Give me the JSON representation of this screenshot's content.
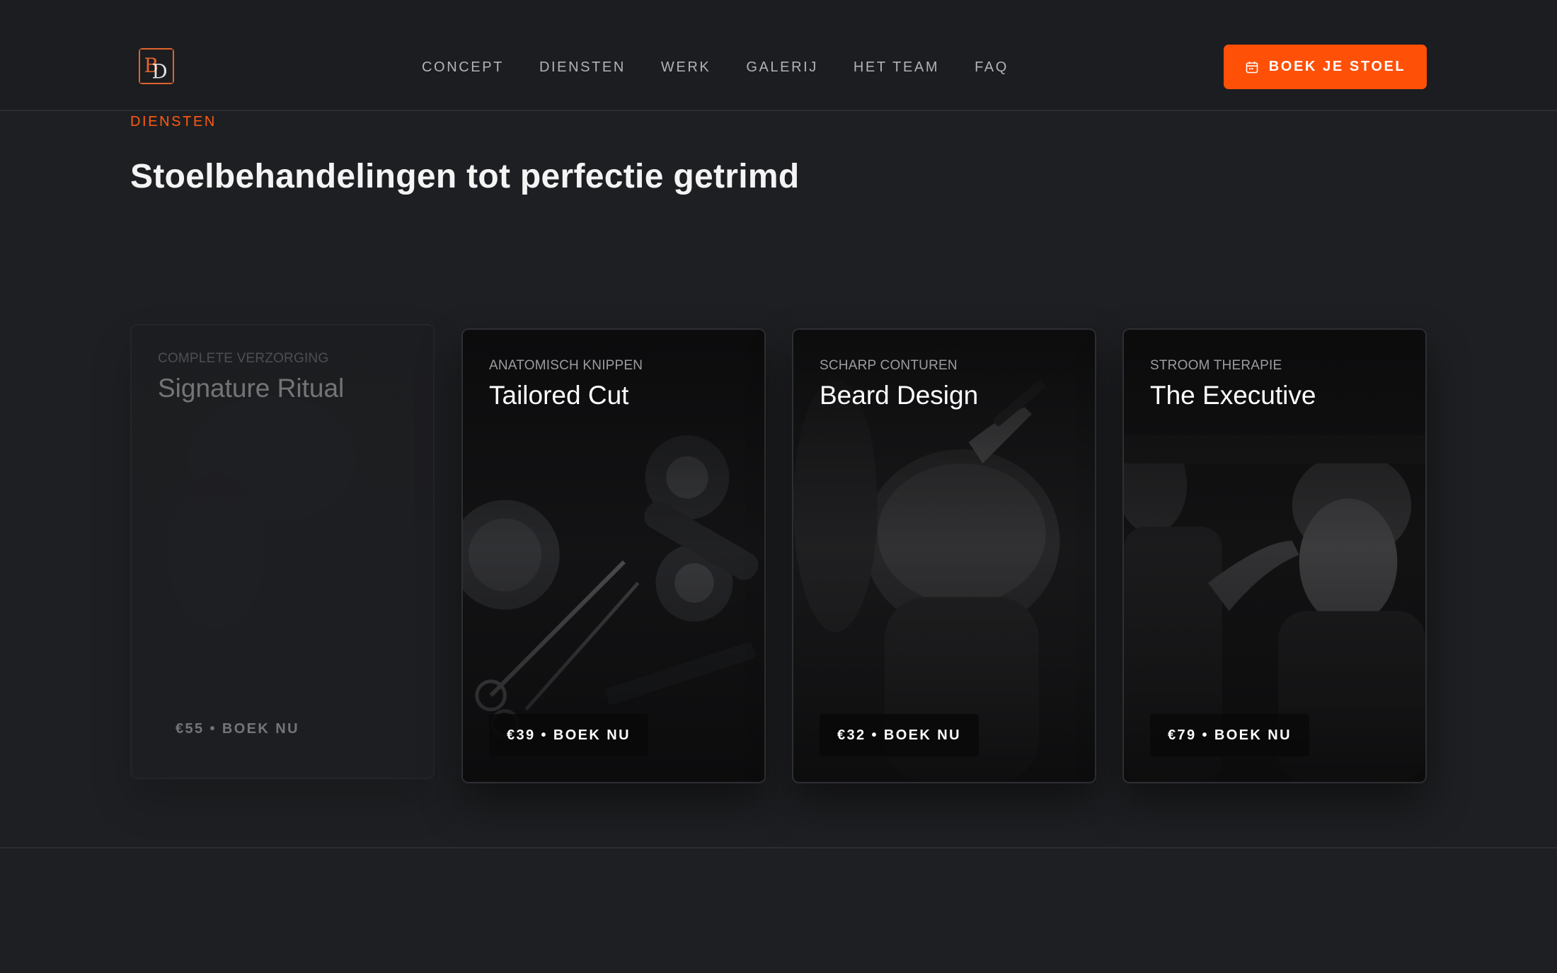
{
  "header": {
    "logo_text": "BD",
    "nav": [
      "CONCEPT",
      "DIENSTEN",
      "WERK",
      "GALERIJ",
      "HET TEAM",
      "FAQ"
    ],
    "cta_label": "BOEK JE STOEL",
    "cta_icon": "calendar-icon"
  },
  "section": {
    "eyebrow": "DIENSTEN",
    "headline": "Stoelbehandelingen tot perfectie getrimd"
  },
  "cards": [
    {
      "subtitle": "COMPLETE VERZORGING",
      "title": "Signature Ritual",
      "price": "€55 • BOEK NU",
      "state": "dimmed"
    },
    {
      "subtitle": "ANATOMISCH KNIPPEN",
      "title": "Tailored Cut",
      "price": "€39 • BOEK NU",
      "state": "active"
    },
    {
      "subtitle": "SCHARP CONTUREN",
      "title": "Beard Design",
      "price": "€32 • BOEK NU",
      "state": "active"
    },
    {
      "subtitle": "STROOM THERAPIE",
      "title": "The Executive",
      "price": "€79 • BOEK NU",
      "state": "active"
    }
  ],
  "colors": {
    "accent": "#ff5008",
    "background": "#1e1f22",
    "header_bg": "#1c1d20",
    "card_bg": "#0a0a0b",
    "text": "#f4f4f5",
    "muted": "#b2b3b6"
  }
}
